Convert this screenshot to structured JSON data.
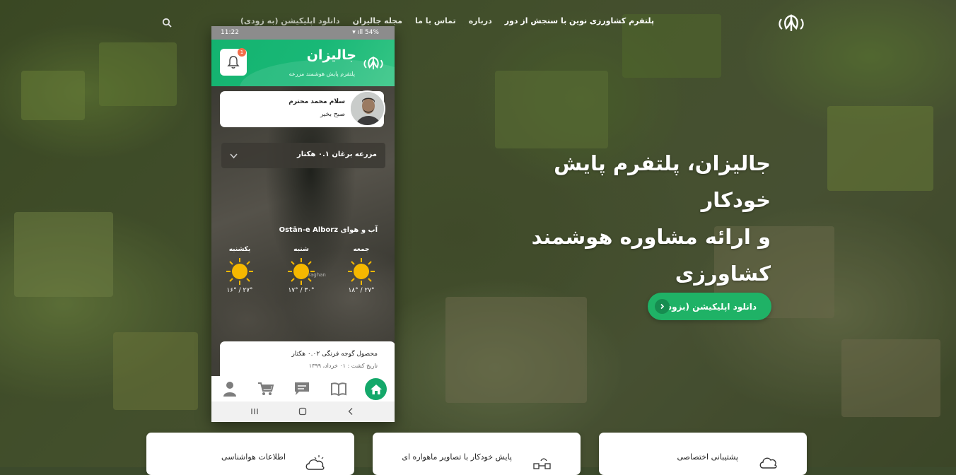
{
  "nav": {
    "links": [
      "پلتفرم کشاورزی نوین با سنجش از دور",
      "درباره",
      "تماس با ما",
      "مجله جالیزان",
      "دانلود اپلیکیشن (به زودی)"
    ]
  },
  "hero": {
    "title_lines": [
      "جالیزان، پلتفرم پایش خودکار",
      "و ارائه مشاوره هوشمند",
      "کشاورزی"
    ],
    "cta_label": "دانلود اپلیکیشن (بزودی)"
  },
  "phone": {
    "status": {
      "time": "11:22",
      "battery": "54%"
    },
    "app_name": "جالیزان",
    "app_tagline": "پلتفرم پایش هوشمند مزرعه",
    "notification_count": "1",
    "greeting": {
      "name": "سلام محمد محترم",
      "sub": "صبح بخیر"
    },
    "farm": "مزرعه برغان  ۰.۱ هکتار",
    "map_place": "Baraghan",
    "weather": {
      "title": "آب و هوای Ostān-e Alborz",
      "days": [
        {
          "name": "جمعه",
          "temp": "۱۸° / ۲۷°"
        },
        {
          "name": "شنبه",
          "temp": "۱۷° / ۳۰°"
        },
        {
          "name": "یکشنبه",
          "temp": "۱۶° / ۲۷°"
        }
      ]
    },
    "crop": {
      "title": "محصول گوجه فرنگی  ۰.۰۲ هکتار",
      "date": "تاریخ کشت : ۰۱ خرداد، ۱۳۹۹"
    }
  },
  "features": [
    {
      "title": "پشتیبانی اختصاصی",
      "icon": "support-cloud-icon"
    },
    {
      "title": "پایش خودکار با تصاویر ماهواره ای",
      "icon": "satellite-icon"
    },
    {
      "title": "اطلاعات هواشناسی",
      "icon": "weather-cloud-icon"
    }
  ],
  "colors": {
    "brand_green": "#1fb266",
    "app_green": "#14b36f",
    "sun": "#f5b800"
  }
}
